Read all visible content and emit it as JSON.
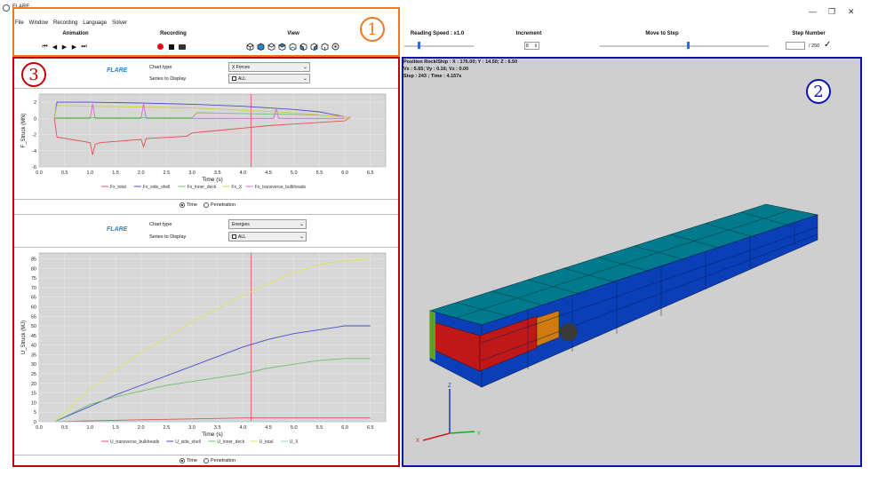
{
  "window": {
    "title": "FLARE",
    "min": "—",
    "max": "❐",
    "close": "✕"
  },
  "menu": [
    "File",
    "Window",
    "Recording",
    "Language",
    "Solver"
  ],
  "toolbar": {
    "animation_label": "Animation",
    "recording_label": "Recording",
    "view_label": "View",
    "reading_speed_label": "Reading Speed : x1.0",
    "increment_label": "Increment",
    "increment_value": "8",
    "move_to_step_label": "Move to Step",
    "step_number_label": "Step Number",
    "step_total": "/ 250"
  },
  "callouts": {
    "one": "1",
    "two": "2",
    "three": "3"
  },
  "colors": {
    "orange": "#f07820",
    "red": "#c40000",
    "blue": "#1010b0"
  },
  "chart1": {
    "logo": "FLARE",
    "chart_type_label": "Chart type",
    "chart_type_value": "X Forces",
    "series_label": "Series to Display",
    "series_value": "ALL"
  },
  "chart2": {
    "logo": "FLARE",
    "chart_type_label": "Chart type",
    "chart_type_value": "Energies",
    "series_label": "Series to Display",
    "series_value": "ALL"
  },
  "radio": {
    "time": "Time",
    "penetration": "Penetration"
  },
  "viewport": {
    "hud_line1": "Position Rock/Ship : X : 176.00; Y : 14.50; Z : 6.50",
    "hud_line2": "Vx : 5.65; Vy : 0.16; Vz : 0.00",
    "hud_line3": "Step : 243 ; Time : 4.157s",
    "axis_z": "Z",
    "axis_y": "Y",
    "axis_x": "X"
  },
  "chart_data": [
    {
      "type": "line",
      "xlabel": "Time (s)",
      "ylabel": "F_Struck (MN)",
      "xlim": [
        0.0,
        6.8
      ],
      "ylim": [
        -6,
        3
      ],
      "x_ticks": [
        "0.0",
        "0.5",
        "1.0",
        "1.5",
        "2.0",
        "2.5",
        "3.0",
        "3.5",
        "4.0",
        "4.5",
        "5.0",
        "5.5",
        "6.0",
        "6.5"
      ],
      "y_ticks": [
        "2",
        "0",
        "-2",
        "-4",
        "-6"
      ],
      "cursor_x": 4.157,
      "legend": [
        "Fx_total",
        "Fx_side_shell",
        "Fx_inner_deck",
        "Fx_X",
        "Fx_transverse_bulkheads"
      ],
      "series": [
        {
          "name": "Fx_total",
          "color": "#e05050",
          "x": [
            0.3,
            0.35,
            1.0,
            1.05,
            1.1,
            1.2,
            2.0,
            2.05,
            2.1,
            2.9,
            3.0,
            3.5,
            4.0,
            4.5,
            5.0,
            5.5,
            6.0,
            6.1
          ],
          "y": [
            0.0,
            -2.3,
            -3.0,
            -4.5,
            -3.2,
            -3.0,
            -2.6,
            -3.5,
            -2.5,
            -2.2,
            -1.8,
            -1.5,
            -1.2,
            -0.9,
            -0.7,
            -0.5,
            -0.3,
            0.2
          ]
        },
        {
          "name": "Fx_side_shell",
          "color": "#4a4ad0",
          "x": [
            0.3,
            0.35,
            1.0,
            2.0,
            3.0,
            4.0,
            5.0,
            5.5,
            6.0,
            6.1
          ],
          "y": [
            0.0,
            2.0,
            2.0,
            1.9,
            1.75,
            1.5,
            1.1,
            0.8,
            0.2,
            0.0
          ]
        },
        {
          "name": "Fx_inner_deck",
          "color": "#70c070",
          "x": [
            0.3,
            0.35,
            1.0,
            2.0,
            3.0,
            3.1,
            4.0,
            5.0,
            5.5,
            6.0,
            6.1
          ],
          "y": [
            0.0,
            0.1,
            0.1,
            0.1,
            0.1,
            0.7,
            0.6,
            0.5,
            0.4,
            0.2,
            0.0
          ]
        },
        {
          "name": "Fx_X",
          "color": "#d0d040",
          "x": [
            0.3,
            0.35,
            1.0,
            2.0,
            3.0,
            4.0,
            5.0,
            6.0,
            6.1
          ],
          "y": [
            0.0,
            1.6,
            1.5,
            1.4,
            1.3,
            1.0,
            0.7,
            0.2,
            0.0
          ]
        },
        {
          "name": "Fx_transverse_bulkheads",
          "color": "#e060e0",
          "x": [
            0.3,
            0.35,
            1.0,
            1.05,
            1.1,
            1.2,
            2.0,
            2.05,
            2.1,
            3.0,
            4.0,
            4.6,
            4.65,
            4.7,
            5.0,
            6.0
          ],
          "y": [
            0.0,
            0.0,
            0.0,
            1.8,
            0.0,
            0.0,
            0.0,
            1.8,
            0.0,
            0.0,
            0.0,
            0.0,
            1.2,
            0.0,
            0.0,
            0.0
          ]
        }
      ]
    },
    {
      "type": "line",
      "xlabel": "Time (s)",
      "ylabel": "U_Struck (MJ)",
      "xlim": [
        0.0,
        6.8
      ],
      "ylim": [
        0,
        88
      ],
      "x_ticks": [
        "0.0",
        "0.5",
        "1.0",
        "1.5",
        "2.0",
        "2.5",
        "3.0",
        "3.5",
        "4.0",
        "4.5",
        "5.0",
        "5.5",
        "6.0",
        "6.5"
      ],
      "y_ticks": [
        "85",
        "80",
        "75",
        "70",
        "65",
        "60",
        "55",
        "50",
        "45",
        "40",
        "35",
        "30",
        "25",
        "20",
        "15",
        "10",
        "5",
        "0"
      ],
      "cursor_x": 4.157,
      "legend": [
        "U_transverse_bulkheads",
        "U_side_shell",
        "U_inner_deck",
        "U_total",
        "U_X"
      ],
      "series": [
        {
          "name": "U_transverse_bulkheads",
          "color": "#e05050",
          "x": [
            0.3,
            1.0,
            2.0,
            3.0,
            4.0,
            5.0,
            6.0,
            6.5
          ],
          "y": [
            0.0,
            0.5,
            1.0,
            1.5,
            2.0,
            2.0,
            2.0,
            2.0
          ]
        },
        {
          "name": "U_side_shell",
          "color": "#4a4ad0",
          "x": [
            0.3,
            1.0,
            1.5,
            2.0,
            2.5,
            3.0,
            3.5,
            4.0,
            4.5,
            5.0,
            5.5,
            6.0,
            6.5
          ],
          "y": [
            0.0,
            8,
            14,
            19,
            24,
            29,
            34,
            39,
            43,
            46,
            48,
            50,
            50
          ]
        },
        {
          "name": "U_inner_deck",
          "color": "#70c070",
          "x": [
            0.3,
            1.0,
            1.5,
            2.0,
            2.5,
            3.0,
            3.5,
            4.0,
            4.5,
            5.0,
            5.5,
            6.0,
            6.5
          ],
          "y": [
            0.0,
            9,
            13,
            16,
            19,
            21,
            23,
            25,
            28,
            30,
            32,
            33,
            33
          ]
        },
        {
          "name": "U_total",
          "color": "#e0e060",
          "x": [
            0.3,
            1.0,
            1.5,
            2.0,
            2.5,
            3.0,
            3.5,
            4.0,
            4.5,
            5.0,
            5.5,
            6.0,
            6.5
          ],
          "y": [
            0.0,
            17,
            27,
            36,
            44,
            52,
            59,
            66,
            72,
            78,
            82,
            84,
            85
          ]
        },
        {
          "name": "U_X",
          "color": "#a0d0e0",
          "x": [
            0.3,
            6.5
          ],
          "y": [
            0.0,
            0.0
          ]
        }
      ]
    }
  ]
}
